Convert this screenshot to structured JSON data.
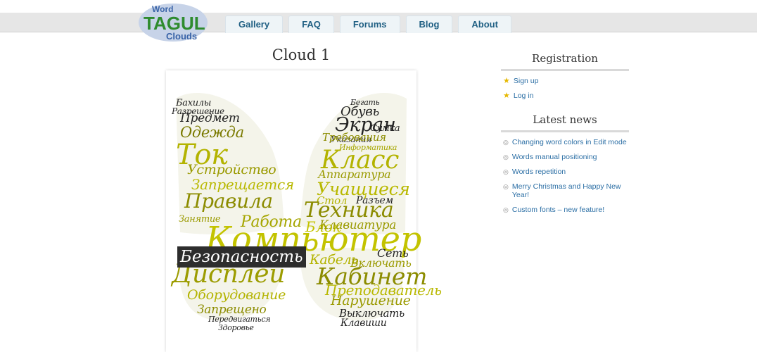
{
  "logo": {
    "text_top": "Word",
    "text_main": "TAGUL",
    "text_bottom": "Clouds"
  },
  "nav": {
    "tabs": [
      "Gallery",
      "FAQ",
      "Forums",
      "Blog",
      "About"
    ]
  },
  "page": {
    "title": "Cloud 1"
  },
  "cloud": {
    "highlight": "Безопасность",
    "words": [
      "Бахилы",
      "Разрешение",
      "Предмет",
      "Одежда",
      "Ток",
      "Устройство",
      "Запрещается",
      "Правила",
      "Занятие",
      "Работа",
      "Компьютер",
      "Дисплей",
      "Оборудование",
      "Запрещено",
      "Передвигаться",
      "Здоровье",
      "Бегать",
      "Обувь",
      "Экран",
      "Указания",
      "Сумка",
      "Требования",
      "Информатика",
      "Класс",
      "Аппаратура",
      "Учащиеся",
      "Стол",
      "Разъем",
      "Техника",
      "Блок",
      "Клавиатура",
      "Сеть",
      "Кабель",
      "Включать",
      "Кабинет",
      "Преподаватель",
      "Нарушение",
      "Выключать",
      "Клавиши"
    ]
  },
  "sidebar": {
    "registration_title": "Registration",
    "sign_up": "Sign up",
    "log_in": "Log in",
    "news_title": "Latest news",
    "news": [
      "Changing word colors in Edit mode",
      "Words manual positioning",
      "Words repetition",
      "Merry Christmas and Happy New Year!",
      "Custom fonts – new feature!"
    ]
  }
}
